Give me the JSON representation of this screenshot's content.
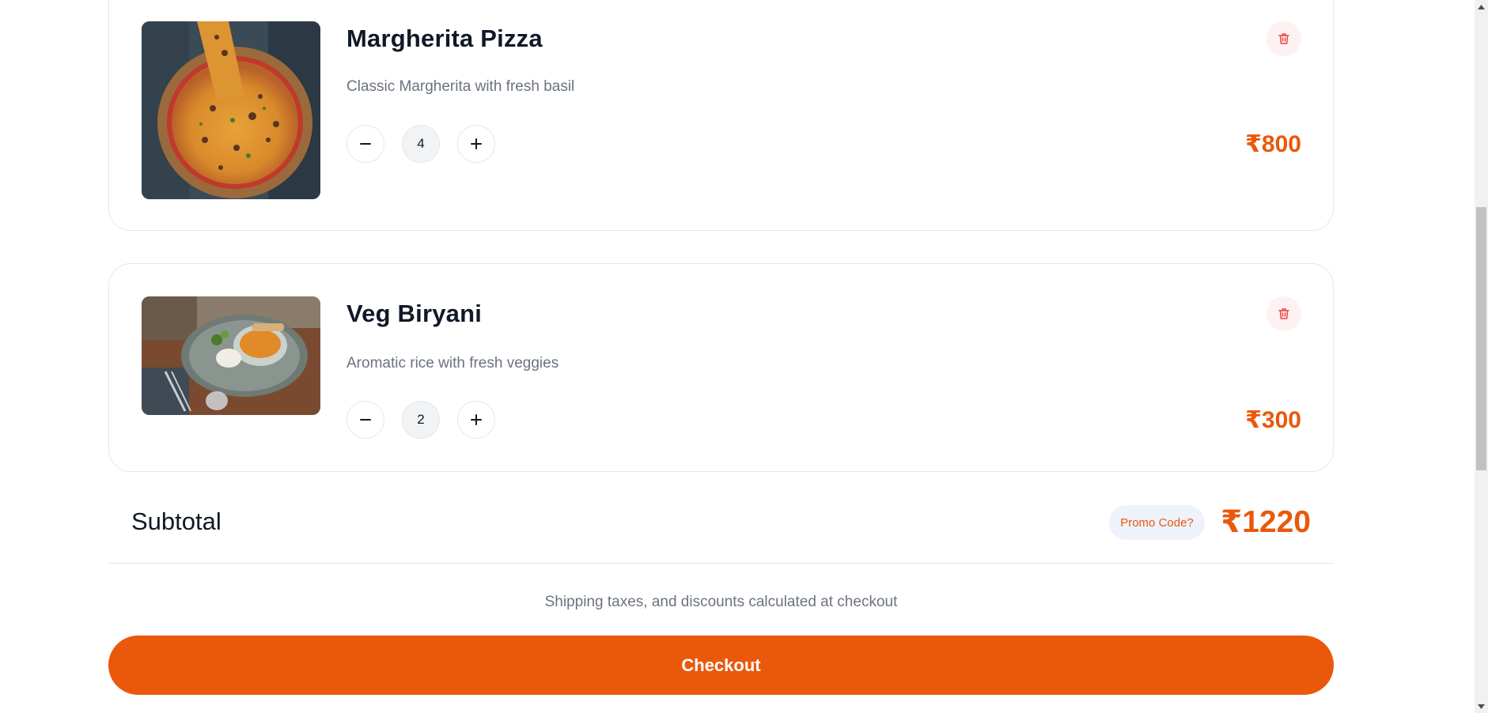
{
  "cart": {
    "items": [
      {
        "name": "Margherita Pizza",
        "description": "Classic Margherita with fresh basil",
        "quantity": "4",
        "price": "₹800",
        "image": "pizza-photo"
      },
      {
        "name": "Veg Biryani",
        "description": "Aromatic rice with fresh veggies",
        "quantity": "2",
        "price": "₹300",
        "image": "biryani-photo"
      }
    ]
  },
  "summary": {
    "subtotal_label": "Subtotal",
    "promo_label": "Promo Code?",
    "subtotal_value": "₹1220",
    "note": "Shipping taxes, and discounts calculated at checkout",
    "checkout_label": "Checkout"
  },
  "icons": {
    "trash": "trash-icon",
    "minus": "minus-icon",
    "plus": "plus-icon"
  },
  "colors": {
    "accent": "#ea580c",
    "trash": "#ef4444",
    "promo_bg": "#eef2fb"
  }
}
